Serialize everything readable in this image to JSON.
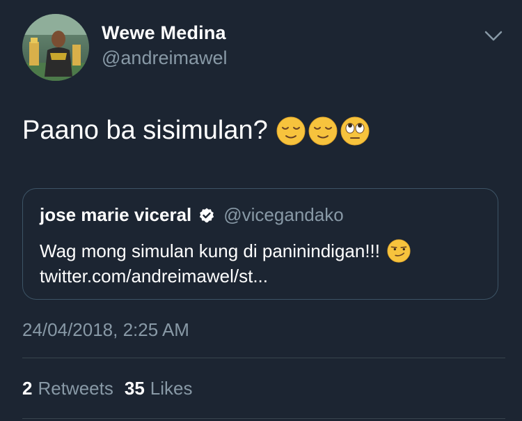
{
  "tweet": {
    "author": {
      "display_name": "Wewe Medina",
      "handle": "@andreimawel",
      "avatar_icon": "user-avatar-photo"
    },
    "text": "Paano ba sisimulan?",
    "emojis": [
      "relieved-face-icon",
      "relieved-face-icon",
      "rolling-eyes-icon"
    ],
    "timestamp": "24/04/2018, 2:25 AM",
    "stats": {
      "retweets_count": "2",
      "retweets_label": "Retweets",
      "likes_count": "35",
      "likes_label": "Likes"
    }
  },
  "quoted_tweet": {
    "display_name": "jose marie viceral",
    "verified": true,
    "handle": "@vicegandako",
    "text": "Wag mong simulan kung di paninindigan!!!",
    "emoji": "smirking-face-icon",
    "link": "twitter.com/andreimawel/st..."
  },
  "colors": {
    "background": "#1c2532",
    "secondary_text": "#8899a6",
    "border": "#3d5466"
  }
}
